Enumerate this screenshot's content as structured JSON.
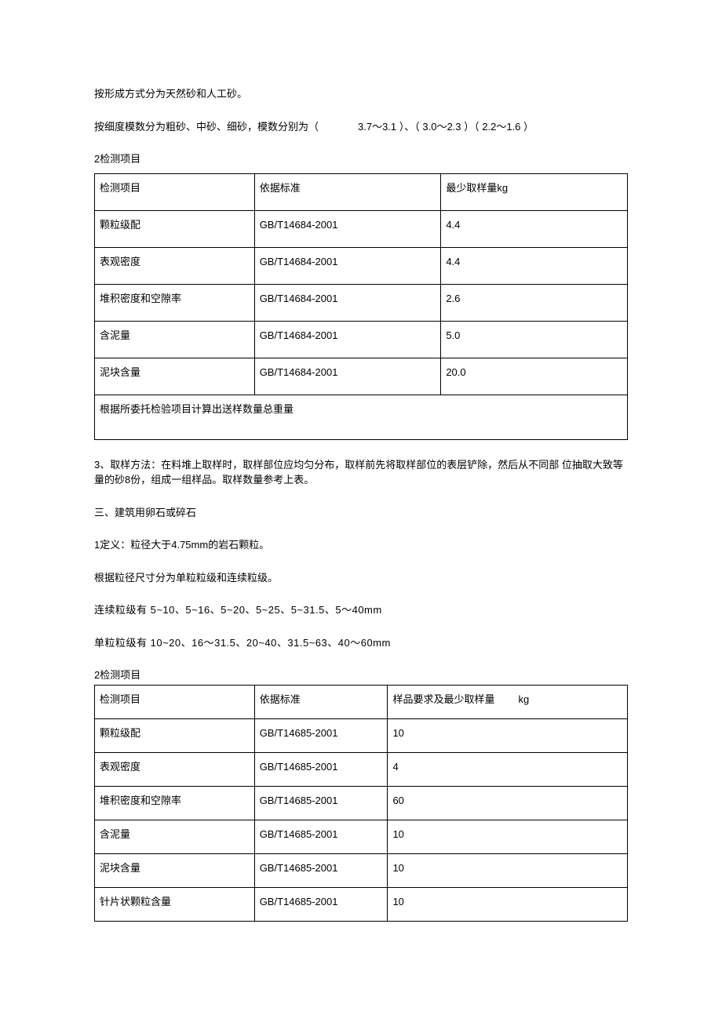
{
  "p1": "按形成方式分为天然砂和人工砂。",
  "p2_pre": "按细度模数分为粗砂、中砂、细砂，模数分别为（",
  "p2_a": "3.7～3.1 ）、（ 3.0～2.3 ）（ 2.2～1.6 ）",
  "sec2": "2检测项目",
  "t1": {
    "h1": "检测项目",
    "h2": "依据标准",
    "h3": "最少取样量kg",
    "rows": [
      {
        "a": "颗粒级配",
        "b": "GB/T14684-2001",
        "c": "4.4"
      },
      {
        "a": "表观密度",
        "b": "GB/T14684-2001",
        "c": "4.4"
      },
      {
        "a": "堆积密度和空隙率",
        "b": "GB/T14684-2001",
        "c": "2.6"
      },
      {
        "a": "含泥量",
        "b": "GB/T14684-2001",
        "c": "5.0"
      },
      {
        "a": "泥块含量",
        "b": "GB/T14684-2001",
        "c": "20.0"
      }
    ],
    "footer": "根据所委托检验项目计算出送样数量总重量"
  },
  "p3": "3、取样方法：在料堆上取样时，取样部位应均匀分布，取样前先将取样部位的表层铲除，然后从不同部 位抽取大致等量的砂8份，组成一组样品。取样数量参考上表。",
  "p4": "三、建筑用卵石或碎石",
  "p5": "1定义：粒径大于4.75mm的岩石颗粒。",
  "p6": "根据粒径尺寸分为单粒粒级和连续粒级。",
  "p7": "连续粒级有 5~10、5~16、5~20、5~25、5~31.5、5～40mm",
  "p8": "单粒粒级有 10~20、16～31.5、20~40、31.5~63、40～60mm",
  "sec2b": "2检测项目",
  "t2": {
    "h1": "检测项目",
    "h2": "依据标准",
    "h3a": "样品要求及最少取样量",
    "h3b": "kg",
    "rows": [
      {
        "a": "颗粒级配",
        "b": "GB/T14685-2001",
        "c": "10"
      },
      {
        "a": "表观密度",
        "b": "GB/T14685-2001",
        "c": "4"
      },
      {
        "a": "堆积密度和空隙率",
        "b": "GB/T14685-2001",
        "c": "60"
      },
      {
        "a": "含泥量",
        "b": "GB/T14685-2001",
        "c": "10"
      },
      {
        "a": "泥块含量",
        "b": "GB/T14685-2001",
        "c": "10"
      },
      {
        "a": "针片状颗粒含量",
        "b": "GB/T14685-2001",
        "c": "10"
      }
    ]
  }
}
